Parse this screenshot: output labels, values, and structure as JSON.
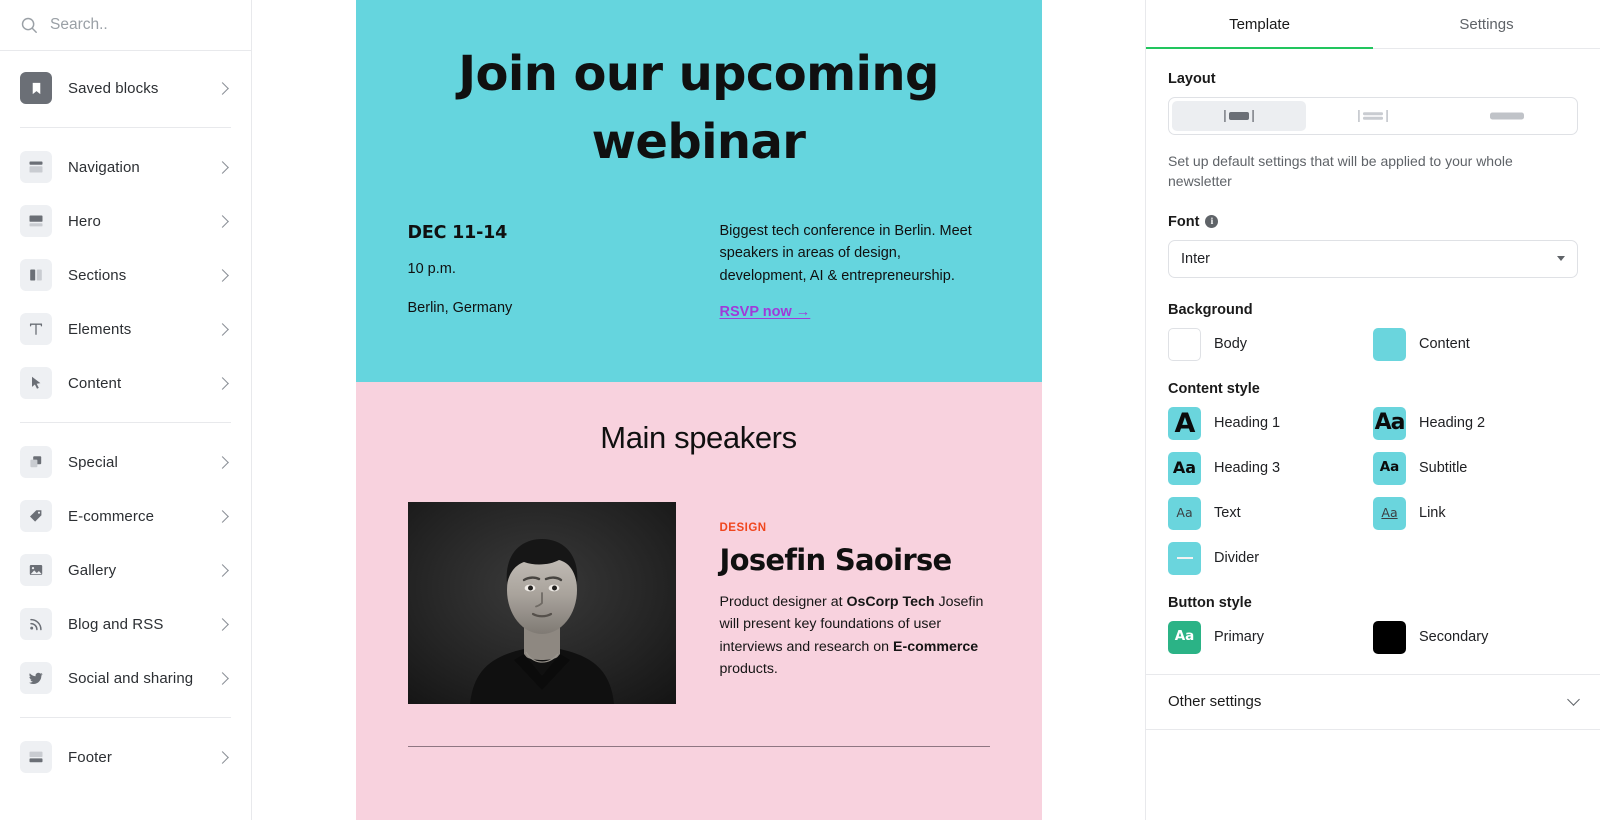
{
  "sidebar": {
    "search": {
      "placeholder": "Search..",
      "value": "",
      "icon": "search-icon"
    },
    "groups": [
      {
        "items": [
          {
            "label": "Saved blocks",
            "icon": "bookmark-icon",
            "highlighted": true
          }
        ]
      },
      {
        "items": [
          {
            "label": "Navigation",
            "icon": "navigation-block-icon"
          },
          {
            "label": "Hero",
            "icon": "hero-block-icon"
          },
          {
            "label": "Sections",
            "icon": "columns-block-icon"
          },
          {
            "label": "Elements",
            "icon": "text-type-icon"
          },
          {
            "label": "Content",
            "icon": "cursor-pointer-icon"
          }
        ]
      },
      {
        "items": [
          {
            "label": "Special",
            "icon": "layers-icon"
          },
          {
            "label": "E-commerce",
            "icon": "price-tag-icon"
          },
          {
            "label": "Gallery",
            "icon": "image-icon"
          },
          {
            "label": "Blog and RSS",
            "icon": "rss-icon"
          },
          {
            "label": "Social and sharing",
            "icon": "twitter-bird-icon"
          }
        ]
      },
      {
        "items": [
          {
            "label": "Footer",
            "icon": "footer-block-icon"
          }
        ]
      }
    ]
  },
  "email_preview": {
    "hero": {
      "bg_color": "#65d5de",
      "title": "Join our upcoming webinar",
      "dates": "DEC 11-14",
      "time": "10 p.m.",
      "location": "Berlin, Germany",
      "description": "Biggest tech conference in Berlin. Meet speakers in areas of design, development, AI & entrepreneurship.",
      "cta_label": "RSVP now →",
      "cta_color": "#a03ad8"
    },
    "speakers": {
      "bg_color": "#f8d2de",
      "heading": "Main speakers",
      "items": [
        {
          "photo_alt": "portrait-photo-of-speaker",
          "tag": "DESIGN",
          "tag_color": "#f0461e",
          "name": "Josefin Saoirse",
          "bio_lead": "Product designer at ",
          "bio_company": "OsCorp Tech",
          "bio_rest_1": "Josefin will present key foundations of user interviews and research on ",
          "bio_bold_2": "E-commerce",
          "bio_rest_2": " products."
        }
      ]
    }
  },
  "right_panel": {
    "tabs": [
      {
        "label": "Template",
        "active": true
      },
      {
        "label": "Settings",
        "active": false
      }
    ],
    "active_tab_underline_color": "#22c55e",
    "layout": {
      "label": "Layout",
      "options": [
        {
          "name": "centered-narrow",
          "selected": true
        },
        {
          "name": "split-rows",
          "selected": false
        },
        {
          "name": "full-width",
          "selected": false
        }
      ],
      "hint": "Set up default settings that will be applied to your whole newsletter"
    },
    "font": {
      "label": "Font",
      "info_icon": "info-icon",
      "value": "Inter"
    },
    "background": {
      "label": "Background",
      "items": [
        {
          "label": "Body",
          "color": "#ffffff"
        },
        {
          "label": "Content",
          "color": "#6ad5dd"
        }
      ]
    },
    "content_style": {
      "label": "Content style",
      "items": [
        {
          "label": "Heading 1",
          "sample": "A",
          "bg": "#6ad5dd"
        },
        {
          "label": "Heading 2",
          "sample": "Aa",
          "bg": "#6ad5dd"
        },
        {
          "label": "Heading 3",
          "sample": "Aa",
          "bg": "#6ad5dd"
        },
        {
          "label": "Subtitle",
          "sample": "Aa",
          "bg": "#6ad5dd"
        },
        {
          "label": "Text",
          "sample": "Aa",
          "bg": "#6ad5dd"
        },
        {
          "label": "Link",
          "sample": "Aa",
          "bg": "#6ad5dd"
        },
        {
          "label": "Divider",
          "sample": "—",
          "bg": "#6ad5dd"
        }
      ]
    },
    "button_style": {
      "label": "Button style",
      "items": [
        {
          "label": "Primary",
          "sample": "Aa",
          "bg": "#2bb386"
        },
        {
          "label": "Secondary",
          "sample": "",
          "bg": "#000000"
        }
      ]
    },
    "other_settings": {
      "label": "Other settings",
      "icon": "chevron-down-icon"
    }
  }
}
